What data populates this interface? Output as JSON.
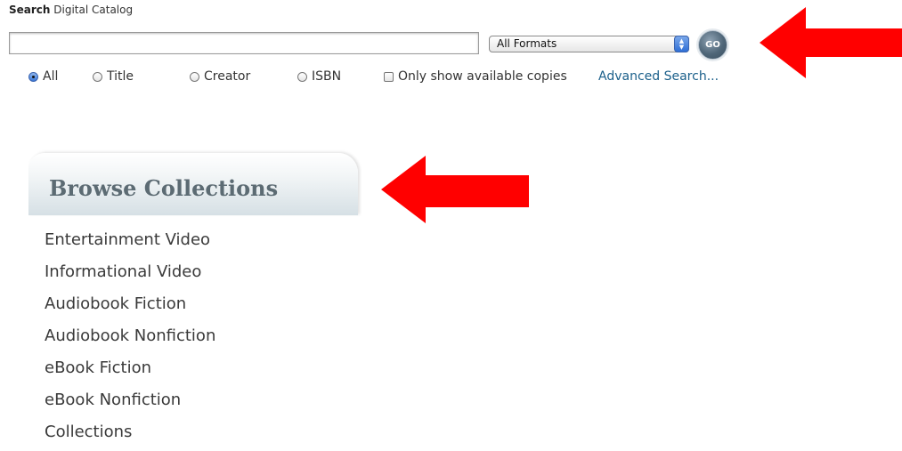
{
  "search": {
    "title_bold": "Search",
    "title_rest": " Digital Catalog",
    "query_value": "",
    "format_selected": "All Formats",
    "go_label": "GO"
  },
  "search_options": {
    "radios": [
      {
        "label": "All",
        "selected": true
      },
      {
        "label": "Title",
        "selected": false
      },
      {
        "label": "Creator",
        "selected": false
      },
      {
        "label": "ISBN",
        "selected": false
      }
    ],
    "available_checkbox_label": "Only show available copies",
    "available_checked": false,
    "advanced_link": "Advanced Search..."
  },
  "browse": {
    "title": "Browse Collections",
    "items": [
      "Entertainment Video",
      "Informational Video",
      "Audiobook Fiction",
      "Audiobook Nonfiction",
      "eBook Fiction",
      "eBook Nonfiction",
      "Collections"
    ]
  },
  "colors": {
    "arrow": "#ff0000",
    "link": "#1a5f8a",
    "browse_title": "#5c6b73"
  }
}
